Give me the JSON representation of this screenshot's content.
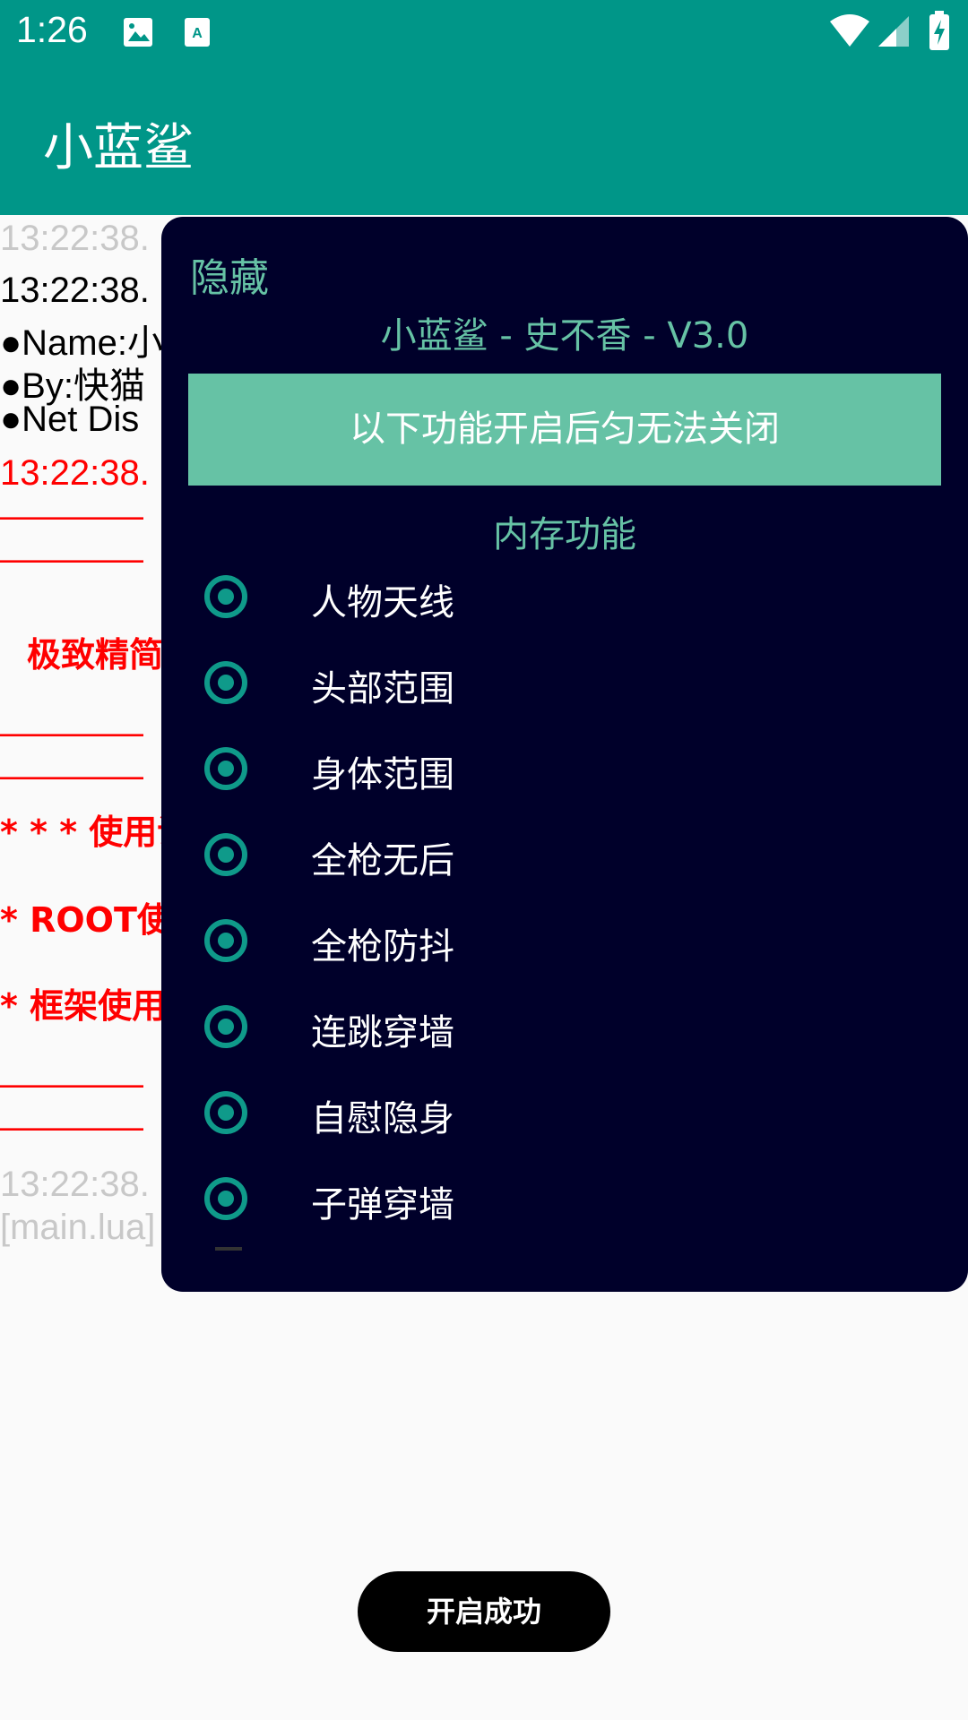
{
  "status_bar": {
    "time": "1:26"
  },
  "app_bar": {
    "title": "小蓝鲨"
  },
  "log": {
    "lines": [
      "13:22:38.",
      "13:22:38.",
      "●Name:小",
      "●By:快猫",
      "●Net Dis",
      "13:22:38.",
      "————",
      "————",
      "极致精简",
      "————",
      "————",
      "* * * 使用说",
      "* ROOT使",
      "* 框架使用",
      "————",
      "————",
      "13:22:38.",
      "[main.lua]"
    ]
  },
  "panel": {
    "hide_label": "隐藏",
    "title": "小蓝鲨 - 史不香 - V3.0",
    "notice": "以下功能开启后匀无法关闭",
    "section": "内存功能",
    "options": [
      "人物天线",
      "头部范围",
      "身体范围",
      "全枪无后",
      "全枪防抖",
      "连跳穿墙",
      "自慰隐身",
      "子弹穿墙"
    ]
  },
  "toast": {
    "text": "开启成功"
  },
  "colors": {
    "primary": "#009688",
    "accent": "#66c2a5",
    "panel_bg": "#00002a"
  }
}
